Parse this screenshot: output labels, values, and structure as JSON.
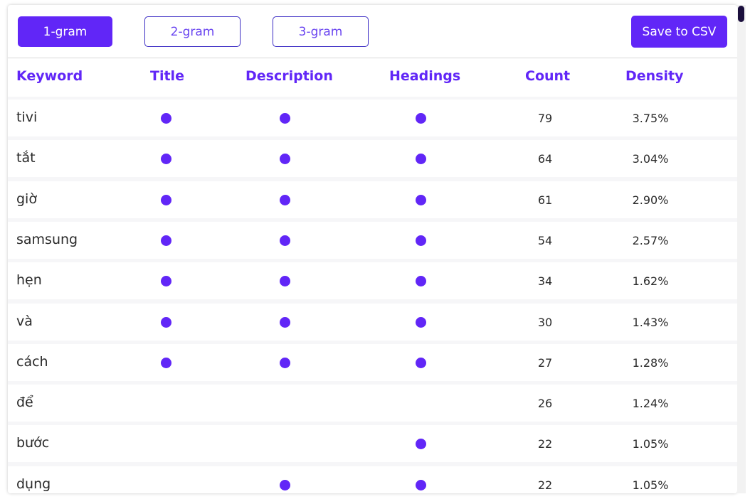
{
  "toolbar": {
    "gram_buttons": [
      {
        "label": "1-gram",
        "active": true
      },
      {
        "label": "2-gram",
        "active": false
      },
      {
        "label": "3-gram",
        "active": false
      }
    ],
    "save_label": "Save to CSV"
  },
  "table": {
    "headers": {
      "keyword": "Keyword",
      "title": "Title",
      "description": "Description",
      "headings": "Headings",
      "count": "Count",
      "density": "Density"
    },
    "rows": [
      {
        "keyword": "tivi",
        "title": true,
        "description": true,
        "headings": true,
        "count": "79",
        "density": "3.75%"
      },
      {
        "keyword": "tắt",
        "title": true,
        "description": true,
        "headings": true,
        "count": "64",
        "density": "3.04%"
      },
      {
        "keyword": "giờ",
        "title": true,
        "description": true,
        "headings": true,
        "count": "61",
        "density": "2.90%"
      },
      {
        "keyword": "samsung",
        "title": true,
        "description": true,
        "headings": true,
        "count": "54",
        "density": "2.57%"
      },
      {
        "keyword": "hẹn",
        "title": true,
        "description": true,
        "headings": true,
        "count": "34",
        "density": "1.62%"
      },
      {
        "keyword": "và",
        "title": true,
        "description": true,
        "headings": true,
        "count": "30",
        "density": "1.43%"
      },
      {
        "keyword": "cách",
        "title": true,
        "description": true,
        "headings": true,
        "count": "27",
        "density": "1.28%"
      },
      {
        "keyword": "để",
        "title": false,
        "description": false,
        "headings": false,
        "count": "26",
        "density": "1.24%"
      },
      {
        "keyword": "bước",
        "title": false,
        "description": false,
        "headings": true,
        "count": "22",
        "density": "1.05%"
      },
      {
        "keyword": "dụng",
        "title": false,
        "description": true,
        "headings": true,
        "count": "22",
        "density": "1.05%"
      }
    ]
  },
  "colors": {
    "accent": "#6126f7",
    "outline_border": "#3b2cc4",
    "text": "#2a2a2a"
  },
  "icons": {
    "presence": "filled-circle-dot-icon"
  }
}
